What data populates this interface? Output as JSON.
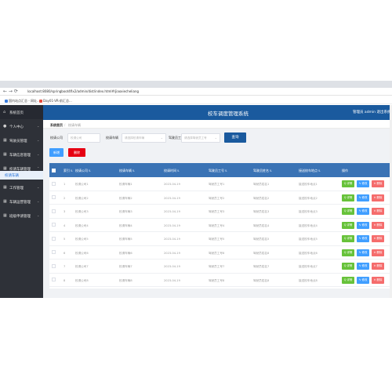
{
  "browser": {
    "url": "localhost:8080/springboot4fix2/admin/dist/index.html#/jiaoxiecheliang",
    "bookmarks": [
      "国内站点汇总 - 网址...",
      "Day01-VR-前汇总..."
    ],
    "accent": "#1a5a9e"
  },
  "sidebar": {
    "items": [
      {
        "label": "系统首页",
        "icon": "home-icon"
      },
      {
        "label": "个人中心",
        "icon": "user-icon"
      },
      {
        "label": "驾驶员管理",
        "icon": "grid-icon"
      },
      {
        "label": "车辆信息管理",
        "icon": "grid-icon"
      },
      {
        "label": "校请车辆管理",
        "icon": "grid-icon"
      },
      {
        "label": "校请车辆",
        "icon": ""
      },
      {
        "label": "工作管理",
        "icon": "grid-icon"
      },
      {
        "label": "车辆运营管理",
        "icon": "grid-icon"
      },
      {
        "label": "班级申请管理",
        "icon": "grid-icon"
      }
    ]
  },
  "header": {
    "title": "校车调度管理系统",
    "user": "管理员 admin  退出系统"
  },
  "breadcrumb": {
    "home": "系统首页",
    "current": "校请车辆"
  },
  "search": {
    "field1_label": "校请公司",
    "field1_placeholder": "校请公司",
    "field2_label": "校请车辆",
    "field2_placeholder": "请选择校请车辆",
    "field3_label": "驾驶员工号",
    "field3_placeholder": "请选择驾驶员工号",
    "query_label": "查询"
  },
  "toolbar": {
    "add_label": "新增",
    "delete_label": "删除"
  },
  "table": {
    "columns": [
      "索引",
      "校请公司",
      "校请车辆",
      "校请时间",
      "驾驶员工号",
      "驾驶员姓名",
      "接送校车地点",
      "操作"
    ],
    "rows": [
      [
        "1",
        "校请公司1",
        "校请车辆1",
        "2023-04-19",
        "驾驶员工号1",
        "驾驶员姓名1",
        "接送校车地点1"
      ],
      [
        "2",
        "校请公司2",
        "校请车辆2",
        "2023-04-19",
        "驾驶员工号2",
        "驾驶员姓名2",
        "接送校车地点2"
      ],
      [
        "3",
        "校请公司3",
        "校请车辆3",
        "2023-04-19",
        "驾驶员工号3",
        "驾驶员姓名3",
        "接送校车地点3"
      ],
      [
        "4",
        "校请公司4",
        "校请车辆4",
        "2023-04-19",
        "驾驶员工号4",
        "驾驶员姓名4",
        "接送校车地点4"
      ],
      [
        "5",
        "校请公司5",
        "校请车辆5",
        "2023-04-19",
        "驾驶员工号5",
        "驾驶员姓名5",
        "接送校车地点5"
      ],
      [
        "6",
        "校请公司6",
        "校请车辆6",
        "2023-04-19",
        "驾驶员工号6",
        "驾驶员姓名6",
        "接送校车地点6"
      ],
      [
        "7",
        "校请公司7",
        "校请车辆7",
        "2023-04-19",
        "驾驶员工号7",
        "驾驶员姓名7",
        "接送校车地点7"
      ],
      [
        "8",
        "校请公司8",
        "校请车辆8",
        "2023-04-19",
        "驾驶员工号8",
        "驾驶员姓名8",
        "接送校车地点8"
      ]
    ],
    "actions": {
      "detail": "Q 详情",
      "edit": "✎ 修改",
      "remove": "✕ 删除"
    }
  },
  "colors": {
    "header": "#1a5a9e",
    "sidebar": "#2e3138",
    "table_header": "#3a73b5",
    "detail": "#67c23a",
    "edit": "#409eff",
    "remove": "#f56c6c",
    "delete_button": "#e60012"
  }
}
